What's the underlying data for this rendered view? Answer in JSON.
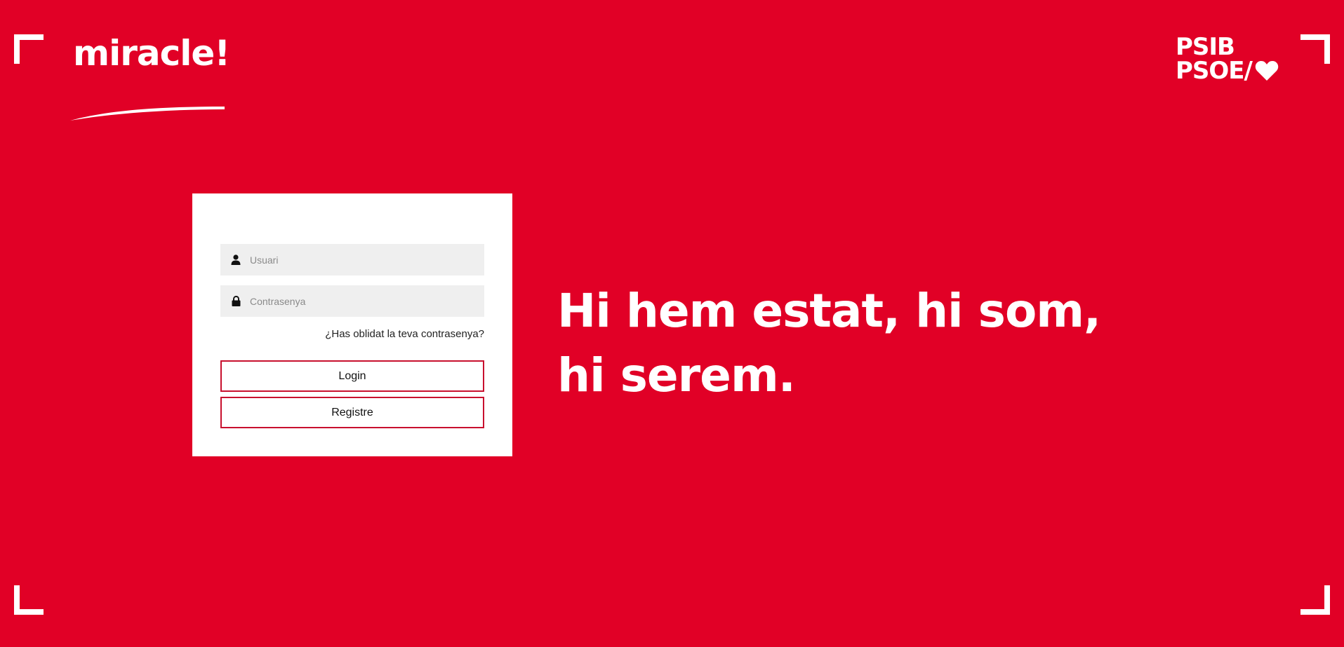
{
  "brand": {
    "logo_text": "miracle!",
    "partner_logo_line1": "PSIB",
    "partner_logo_line2": "PSOE/"
  },
  "login": {
    "username_placeholder": "Usuari",
    "password_placeholder": "Contrasenya",
    "forgot_password": "¿Has oblidat la teva contrasenya?",
    "login_button": "Login",
    "register_button": "Registre"
  },
  "headline": "Hi hem estat, hi som, hi serem.",
  "icons": {
    "username": "user-icon",
    "password": "lock-icon",
    "partner": "heart-icon"
  },
  "colors": {
    "background": "#e10026",
    "button_border": "#c8102e",
    "field_background": "#efefef"
  }
}
